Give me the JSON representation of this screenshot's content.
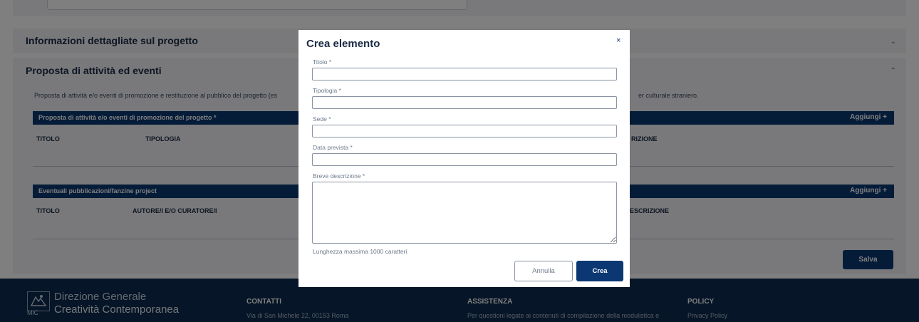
{
  "sections": {
    "details_title": "Informazioni dettagliate sul progetto",
    "activities_title": "Proposta di attività ed eventi",
    "activities_intro": "Proposta di attività e/o eventi di promozione e restituzione al pubblico del progetto (es",
    "activities_intro_tail": "er culturale straniero."
  },
  "tables": [
    {
      "title": "Proposta di attività e/o eventi di promozione del progetto *",
      "add_label": "Aggiungi  +",
      "columns": [
        "TITOLO",
        "TIPOLOGIA",
        "RIZIONE"
      ]
    },
    {
      "title": "Eventuali pubblicazioni/fanzine project",
      "add_label": "Aggiungi  +",
      "columns": [
        "TITOLO",
        "AUTORE/I E/O CURATORE/I",
        "ESCRIZIONE"
      ]
    }
  ],
  "save_label": "Salva",
  "footer": {
    "logo_line1": "Direzione Generale",
    "logo_line2": "Creatività Contemporanea",
    "logo_mic": "MiC",
    "contacts_title": "CONTATTI",
    "contacts_text": "Via di San Michele 22, 00153 Roma",
    "support_title": "ASSISTENZA",
    "support_text": "Per questioni legate ai contenuti di compilazione della modulistica e",
    "policy_title": "POLICY",
    "policy_text": "Privacy Policy"
  },
  "modal": {
    "title": "Crea elemento",
    "close_icon": "×",
    "fields": {
      "titolo": {
        "label": "Titolo *",
        "value": ""
      },
      "tipologia": {
        "label": "Tipologia *",
        "value": ""
      },
      "sede": {
        "label": "Sede *",
        "value": ""
      },
      "data_prevista": {
        "label": "Data prevista *",
        "value": ""
      },
      "breve_descrizione": {
        "label": "Breve descrizione *",
        "value": ""
      }
    },
    "hint": "Lunghezza massima 1000 caratteri",
    "cancel_label": "Annulla",
    "create_label": "Crea"
  },
  "icons": {
    "close": "close-icon",
    "chevron_down": "chevron-down-icon",
    "chevron_up": "chevron-up-icon",
    "logo": "logo-icon"
  },
  "colors": {
    "primary": "#0b3873",
    "footer": "#0c2b4e",
    "card_bg": "#f2f3f6"
  }
}
